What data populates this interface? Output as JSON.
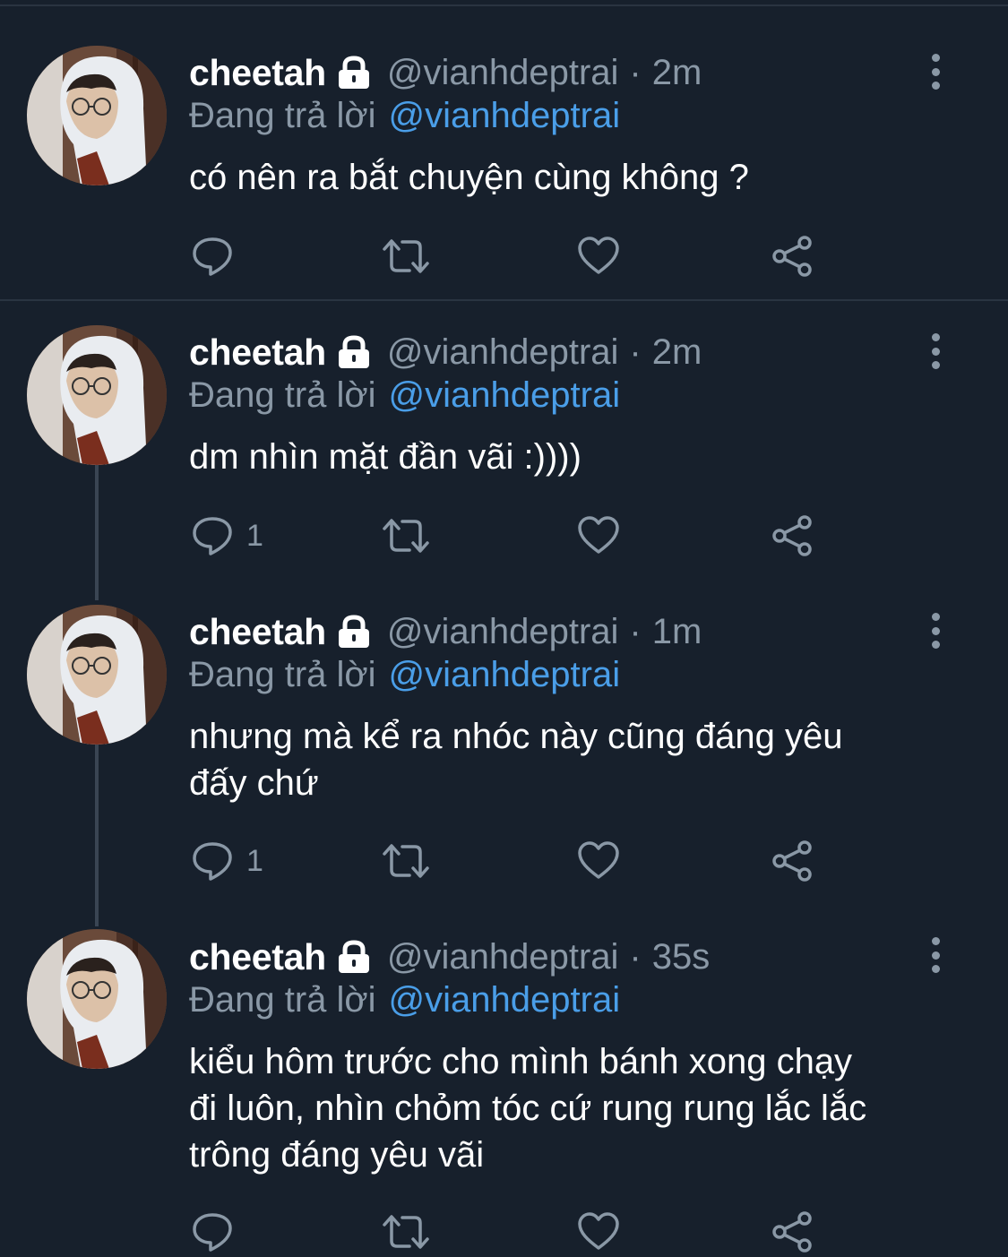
{
  "replying_prefix": "Đang trả lời",
  "tweets": [
    {
      "name": "cheetah",
      "handle": "@vianhdeptrai",
      "separator": "·",
      "time": "2m",
      "replying_to": "@vianhdeptrai",
      "text_lines": [
        "có nên ra bắt chuyện cùng không ?"
      ],
      "reply_count": ""
    },
    {
      "name": "cheetah",
      "handle": "@vianhdeptrai",
      "separator": "·",
      "time": "2m",
      "replying_to": "@vianhdeptrai",
      "text_lines": [
        "dm nhìn mặt đần vãi :))))"
      ],
      "reply_count": "1"
    },
    {
      "name": "cheetah",
      "handle": "@vianhdeptrai",
      "separator": "·",
      "time": "1m",
      "replying_to": "@vianhdeptrai",
      "text_lines": [
        "nhưng mà kể ra nhóc này cũng đáng yêu",
        "đấy chứ"
      ],
      "reply_count": "1"
    },
    {
      "name": "cheetah",
      "handle": "@vianhdeptrai",
      "separator": "·",
      "time": "35s",
      "replying_to": "@vianhdeptrai",
      "text_lines": [
        "kiểu hôm trước cho mình bánh xong chạy",
        "đi luôn, nhìn chỏm tóc cứ rung rung lắc lắc",
        "trông đáng yêu vãi"
      ],
      "reply_count": ""
    }
  ],
  "icons": {
    "lock": "lock-icon",
    "reply": "reply-icon",
    "retweet": "retweet-icon",
    "like": "heart-icon",
    "share": "share-icon",
    "more": "more-vertical-icon"
  },
  "colors": {
    "background": "#17202c",
    "name": "#ffffff",
    "muted": "#8a98a6",
    "link": "#4a9ee8",
    "divider": "#2a3441",
    "thread_line": "#3a4553"
  }
}
